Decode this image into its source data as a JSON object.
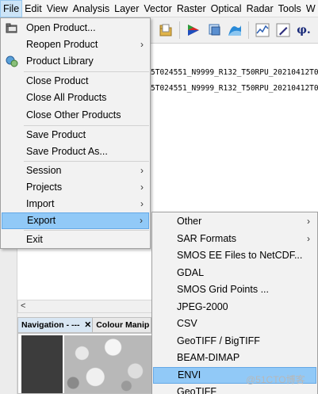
{
  "menubar": {
    "items": [
      "File",
      "Edit",
      "View",
      "Analysis",
      "Layer",
      "Vector",
      "Raster",
      "Optical",
      "Radar",
      "Tools",
      "W"
    ]
  },
  "toolbar": {
    "icons": [
      "folder-icon",
      "color-manipulation-icon",
      "image-stack-icon",
      "wave-icon",
      "profile-plot-icon",
      "pencil-icon",
      "phi-icon"
    ],
    "phi_label": "φ."
  },
  "products": [
    "5T024551_N9999_R132_T50RPU_20210412T07",
    "5T024551_N9999_R132_T50RPU_20210412T07"
  ],
  "file_menu": {
    "items": [
      {
        "label": "Open Product...",
        "icon": "open-folder-icon",
        "submenu": false
      },
      {
        "label": "Reopen Product",
        "submenu": true
      },
      {
        "label": "Product Library",
        "icon": "product-library-icon",
        "submenu": false
      },
      {
        "label": "Close Product",
        "submenu": false
      },
      {
        "label": "Close All Products",
        "submenu": false
      },
      {
        "label": "Close Other Products",
        "submenu": false
      },
      {
        "label": "Save Product",
        "submenu": false
      },
      {
        "label": "Save Product As...",
        "submenu": false
      },
      {
        "label": "Session",
        "submenu": true
      },
      {
        "label": "Projects",
        "submenu": true
      },
      {
        "label": "Import",
        "submenu": true
      },
      {
        "label": "Export",
        "submenu": true,
        "selected": true
      },
      {
        "label": "Exit",
        "submenu": false
      }
    ]
  },
  "export_menu": {
    "items": [
      {
        "label": "Other",
        "submenu": true
      },
      {
        "label": "SAR Formats",
        "submenu": true
      },
      {
        "label": "SMOS EE Files to NetCDF...",
        "submenu": false
      },
      {
        "label": "GDAL",
        "submenu": false
      },
      {
        "label": "SMOS Grid Points ...",
        "submenu": false
      },
      {
        "label": "JPEG-2000",
        "submenu": false
      },
      {
        "label": "CSV",
        "submenu": false
      },
      {
        "label": "GeoTIFF / BigTIFF",
        "submenu": false
      },
      {
        "label": "BEAM-DIMAP",
        "submenu": false
      },
      {
        "label": "ENVI",
        "submenu": false,
        "selected": true
      },
      {
        "label": "GeoTIFF",
        "submenu": false
      }
    ]
  },
  "panels": {
    "navigation_tab": "Navigation - ---",
    "close_symbol": "✕",
    "colour_tab": "Colour Manip"
  },
  "scroll_left_arrow": "<",
  "chevron": "›",
  "watermark": "@51CTO博客",
  "colors": {
    "selection": "#91c9f7",
    "menu_bg": "#f2f2f2",
    "active_menubar": "#cce4f7"
  }
}
